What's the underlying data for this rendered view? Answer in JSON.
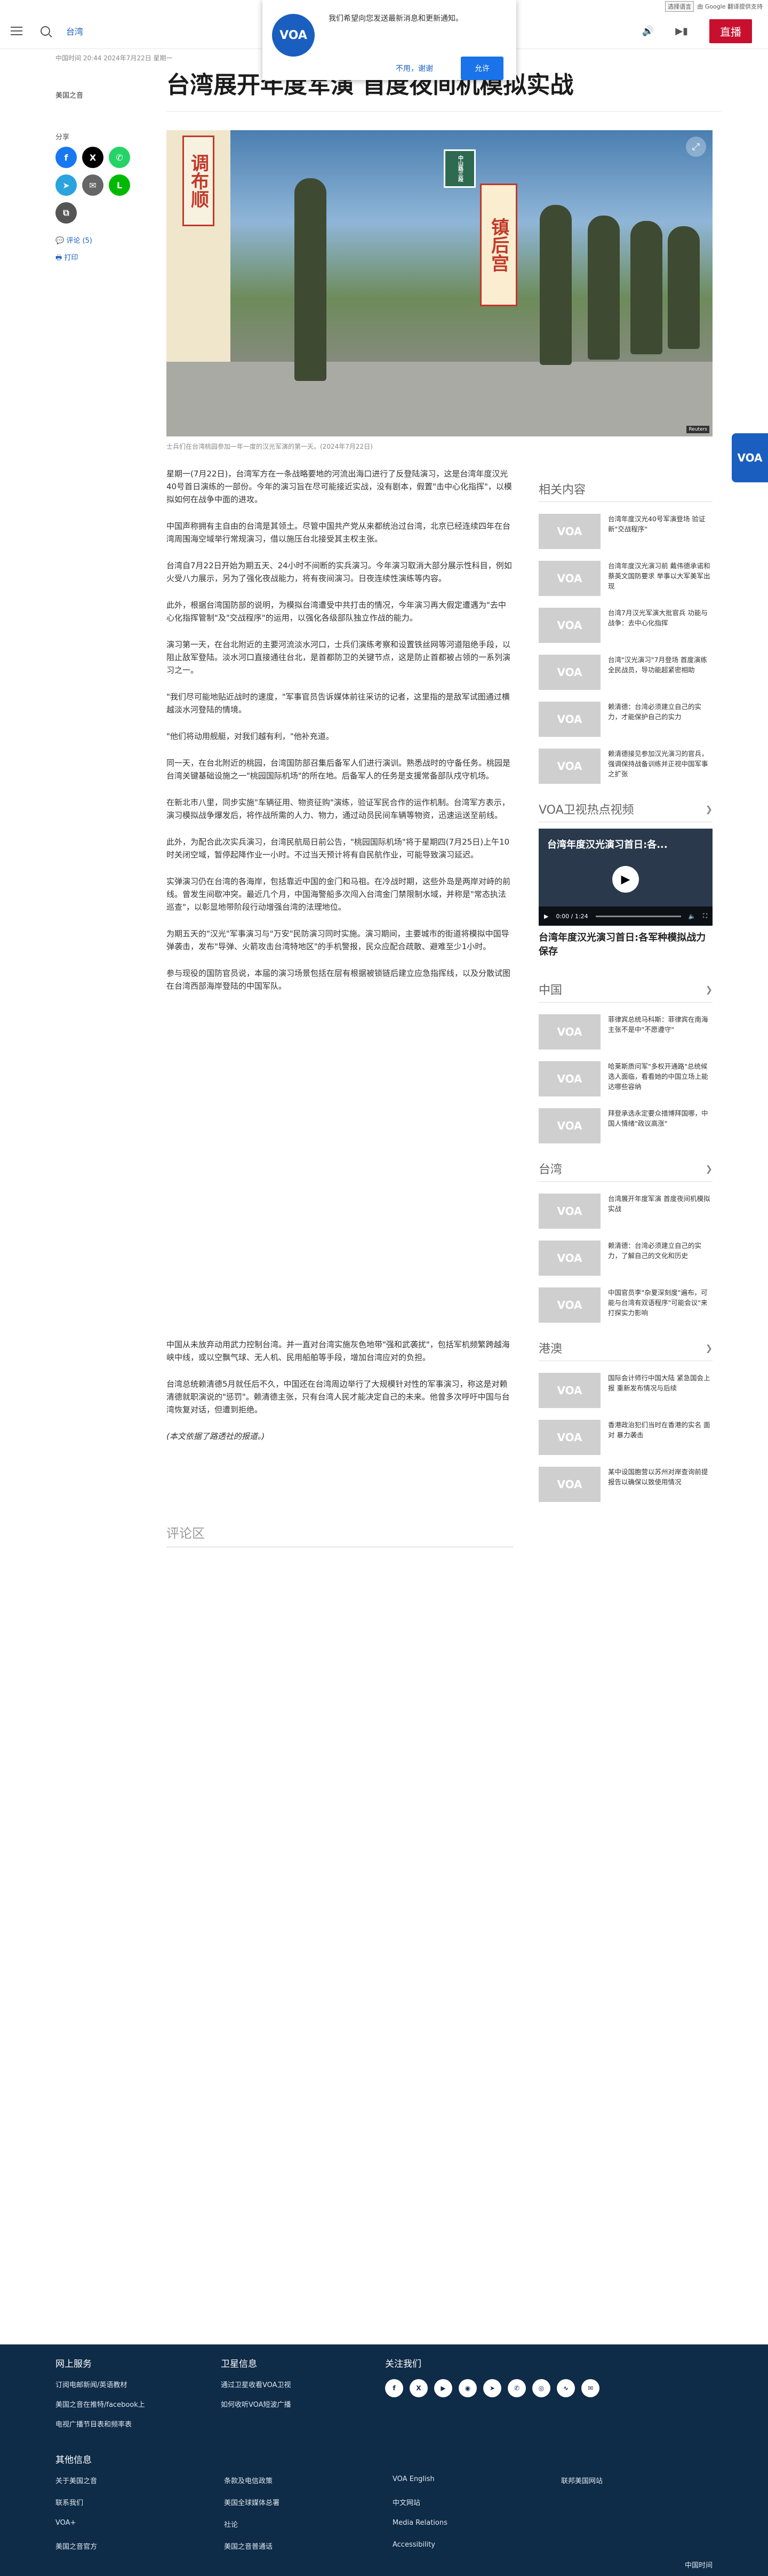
{
  "topbar": {
    "lang_select": "选择语言",
    "google": "由 Google 翻译提供支持"
  },
  "header": {
    "nav_tab": "台湾",
    "live_label": "直播"
  },
  "notification": {
    "message": "我们希望向您发送最新消息和更新通知。",
    "decline": "不用，谢谢",
    "accept": "允许",
    "logo": "VOA"
  },
  "article": {
    "dates": "中国时间 20:44 2024年7月22日 星期一",
    "author": "美国之音",
    "title": "台湾展开年度军演 首度夜间机模拟实战",
    "share_label": "分享",
    "comments_link": "评论 (5)",
    "print_link": "打印",
    "caption": "士兵们在台湾桃园参加一年一度的汉光军演的第一天。(2024年7月22日)",
    "hero_signs": {
      "sign1": "调布顺",
      "sign2": "镇后宫",
      "sign3": "中山路三段"
    },
    "hero_tag": "Reuters",
    "paragraphs": [
      "星期一(7月22日)，台湾军方在一条战略要地的河流出海口进行了反登陆演习，这是台湾年度汉光40号首日演练的一部份。今年的演习旨在尽可能接近实战，没有剧本，假置\"击中心化指挥\"，以模拟如何在战争中面的进攻。",
      "中国声称拥有主自由的台湾是其领土。尽管中国共产党从来都统治过台湾，北京已经连续四年在台湾周围海空域举行常规演习，借以施压台北接受其主权主张。",
      "台湾自7月22日开始为期五天、24小时不间断的实兵演习。今年演习取消大部分展示性科目，例如火受八力展示，另为了强化夜战能力，将有夜间演习。日夜连续性演练等内容。",
      "此外，根据台湾国防部的说明，为模拟台湾遭受中共打击的情况，今年演习再大假定遭遇为\"去中心化指挥管制\"及\"交战程序\"的运用，以强化各级部队独立作战的能力。",
      "演习第一天，在台北附近的主要河流淡水河口，士兵们演练考察和设置铁丝网等河道阻绝手段，以阻止敌军登陆。淡水河口直接通往台北，是首都防卫的关键节点，这是防止首都被占领的一系列演习之一。",
      "\"我们尽可能地贴近战时的速度，\"军事官员告诉媒体前往采访的记者，这里指的是敌军试图通过横越淡水河登陆的情境。",
      "\"他们将动用舰艇，对我们越有利，\"他补充道。",
      "同一天，在台北附近的桃园，台湾国防部召集后备军人们进行演训。熟悉战时的守备任务。桃园是台湾关键基础设施之一\"桃园国际机场\"的所在地。后备军人的任务是支援常备部队戍守机场。",
      "在新北市八里，同步实施\"车辆征用、物资征购\"演练，验证军民合作的运作机制。台湾军方表示，演习模拟战争爆发后，将作战所需的人力、物力，通过动员民间车辆等物资，迅速运送至前线。",
      "此外，为配合此次实兵演习，台湾民航局日前公告，\"桃园国际机场\"将于星期四(7月25日)上午10时关闭空域，暂停起降作业一小时。不过当天预计将有自民航作业，可能导致演习延迟。",
      "实弹演习仍在台湾的各海岸，包括靠近中国的金门和马祖。在冷战时期，这些外岛是两岸对峙的前线。曾发生间歇冲突。最近几个月，中国海警船多次闯入台湾金门禁限制水域，并称是\"常态执法巡查\"，以彰显地带阶段行动增强台湾的法理地位。",
      "为期五天的\"汉光\"军事演习与\"万安\"民防演习同时实施。演习期间，主要城市的街道将模拟中国导弹袭击，发布\"导弹、火箭攻击台湾特地区\"的手机警报，民众应配合疏散、避难至少1小时。",
      "参与现役的国防官员说，本届的演习场景包括在层有根据被锁链后建立应急指挥线，以及分散试图在台湾西部海岸登陆的中国军队。"
    ],
    "paragraphs2": [
      "中国从未放弃动用武力控制台湾。并一直对台湾实施灰色地带\"强和武袭扰\"，包括军机频繁跨越海峡中线，或以空飘气球、无人机、民用船舶等手段，增加台湾应对的负担。",
      "台湾总统赖清德5月就任后不久，中国还在台湾周边举行了大规模针对性的军事演习，称这是对赖清德就职演说的\"惩罚\"。赖清德主张，只有台湾人民才能决定自己的未来。他曾多次呼吁中国与台湾恢复对话，但遭到拒绝。",
      "(本文依据了路透社的报道。)"
    ],
    "comments_title": "评论区"
  },
  "share_icons": [
    "facebook-icon",
    "x-icon",
    "whatsapp-icon",
    "telegram-icon",
    "email-icon",
    "line-icon",
    "copy-link-icon"
  ],
  "sidebar": {
    "related_title": "相关内容",
    "related": [
      "台湾年度汉光40号军演登场 验证新\"交战程序\"",
      "台湾年度汉光演习前 戴伟德承诺和蔡英文国防要求 举事以大军美军出现",
      "台湾7月汉光军演大批官兵 功能与战争：去中心化指挥",
      "台湾\"汉光演习\"7月登场 首度演练全民战员，导功能超紧密相助",
      "赖清德：台湾必须建立自己的实力，才能保护自己的实力",
      "赖清德接见参加汉光演习的官兵，强调保持战备训练并正视中国军事之扩张"
    ],
    "video_title": "VOA卫视热点视频",
    "video_overlay": "台湾年度汉光演习首日:各...",
    "video_time": "0:00 / 1:24",
    "video_caption": "台湾年度汉光演习首日:各军种模拟战力保存",
    "china_title": "中国",
    "china": [
      "菲律宾总统马科斯：菲律宾在南海主张不是中\"不愿遵守\"",
      "哈莱斯质问军\"多权开通路\"总统候选人面临，看看她的中国立场上能达哪些容纳",
      "拜登承选永定要众措博拜国哪，中国人情绪\"政议高涨\""
    ],
    "taiwan_title": "台湾",
    "taiwan": [
      "台湾展开年度军演 首度夜间机模拟实战",
      "赖清德：台湾必须建立自己的实力，了解自己的文化和历史",
      "中国官员李\"杂夏深刻度\"遍布，可能与台湾有双语程序\"可能会议\"来打探实力影响"
    ],
    "hk_title": "港澳",
    "hk": [
      "国际会计师行中国大陆 紧急国会上报 重新发布情况与后续",
      "香港政治犯们当时在香港的实名 面对 暴力袭击",
      "某中设国胞营以苏州对岸查询前提报告以确保以致使用情况"
    ]
  },
  "footer": {
    "col1_title": "网上服务",
    "col1": [
      "订阅电邮新闻/英语教材",
      "美国之音在推特/facebook上",
      "电视广播节目表和频率表"
    ],
    "col2_title": "卫星信息",
    "col2": [
      "通过卫星收看VOA卫视",
      "如何收听VOA短波广播"
    ],
    "col3_title": "关注我们",
    "social_icons": [
      "facebook-icon",
      "x-icon",
      "youtube-icon",
      "instagram-icon",
      "telegram-icon",
      "whatsapp-icon",
      "podcast-icon",
      "rss-icon",
      "email-icon"
    ],
    "other_title": "其他信息",
    "other": [
      "关于美国之音",
      "条款及电信政策",
      "VOA English",
      "联邦美国网站",
      "联系我们",
      "美国全球媒体总署",
      "中文网站",
      "",
      "VOA+",
      "社论",
      "Media Relations",
      "",
      "美国之音官方",
      "美国之音普通话",
      "Accessibility",
      ""
    ],
    "copyright": "中国时间"
  }
}
